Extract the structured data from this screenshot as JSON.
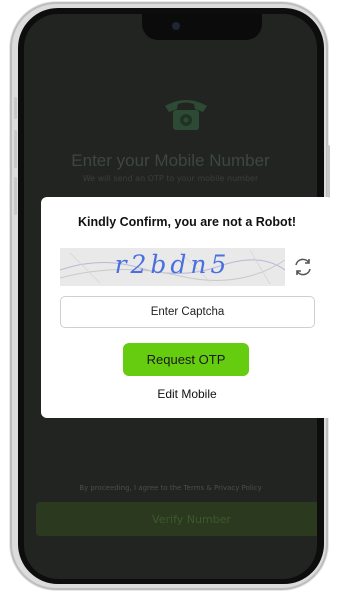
{
  "background": {
    "title": "Enter your Mobile Number",
    "subtitle": "We will send an OTP to your mobile number",
    "terms": "By proceeding, I agree to the Terms & Privacy Policy",
    "verify_button": "Verify Number",
    "phone_icon": "telephone-icon"
  },
  "modal": {
    "title": "Kindly Confirm, you are not a Robot!",
    "captcha_text": "r2bdn5",
    "captcha_input_placeholder": "Enter Captcha",
    "request_otp_button": "Request OTP",
    "edit_mobile_link": "Edit Mobile",
    "refresh_icon": "refresh-icon"
  },
  "colors": {
    "accent_green": "#66cc10",
    "screen_overlay": "#222422",
    "captcha_blue": "#4a6fe0"
  }
}
